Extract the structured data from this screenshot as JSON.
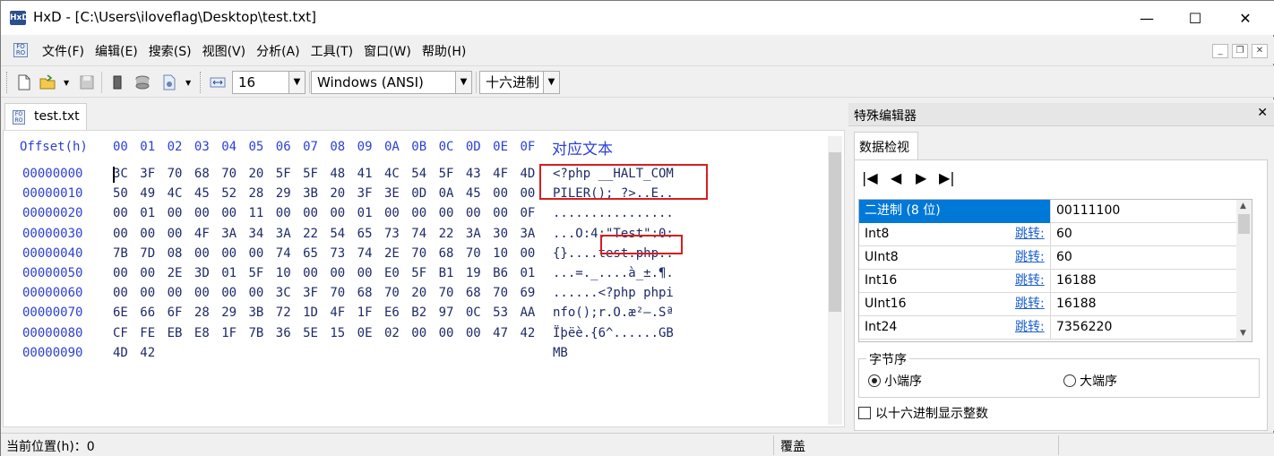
{
  "window": {
    "app_icon": "HxD",
    "title": "HxD - [C:\\Users\\iloveflag\\Desktop\\test.txt]",
    "minimize": "—",
    "maximize": "☐",
    "close": "✕"
  },
  "menu": {
    "items": [
      "文件(F)",
      "编辑(E)",
      "搜索(S)",
      "视图(V)",
      "分析(A)",
      "工具(T)",
      "窗口(W)",
      "帮助(H)"
    ],
    "mdi_min": "_",
    "mdi_restore": "❐",
    "mdi_close": "✕"
  },
  "toolbar": {
    "bytes_per_row": "16",
    "charset": "Windows (ANSI)",
    "offset_base": "十六进制"
  },
  "editor": {
    "tab_label": "test.txt",
    "header_offset": "Offset(h)",
    "header_cols": [
      "00",
      "01",
      "02",
      "03",
      "04",
      "05",
      "06",
      "07",
      "08",
      "09",
      "0A",
      "0B",
      "0C",
      "0D",
      "0E",
      "0F"
    ],
    "header_text": "对应文本",
    "rows": [
      {
        "offset": "00000000",
        "bytes": [
          "3C",
          "3F",
          "70",
          "68",
          "70",
          "20",
          "5F",
          "5F",
          "48",
          "41",
          "4C",
          "54",
          "5F",
          "43",
          "4F",
          "4D"
        ],
        "text": "<?php __HALT_COM"
      },
      {
        "offset": "00000010",
        "bytes": [
          "50",
          "49",
          "4C",
          "45",
          "52",
          "28",
          "29",
          "3B",
          "20",
          "3F",
          "3E",
          "0D",
          "0A",
          "45",
          "00",
          "00"
        ],
        "text": "PILER(); ?>..E.."
      },
      {
        "offset": "00000020",
        "bytes": [
          "00",
          "01",
          "00",
          "00",
          "00",
          "11",
          "00",
          "00",
          "00",
          "01",
          "00",
          "00",
          "00",
          "00",
          "00",
          "0F"
        ],
        "text": "................"
      },
      {
        "offset": "00000030",
        "bytes": [
          "00",
          "00",
          "00",
          "4F",
          "3A",
          "34",
          "3A",
          "22",
          "54",
          "65",
          "73",
          "74",
          "22",
          "3A",
          "30",
          "3A"
        ],
        "text": "...O:4:\"Test\":0:"
      },
      {
        "offset": "00000040",
        "bytes": [
          "7B",
          "7D",
          "08",
          "00",
          "00",
          "00",
          "74",
          "65",
          "73",
          "74",
          "2E",
          "70",
          "68",
          "70",
          "10",
          "00"
        ],
        "text": "{}....test.php.."
      },
      {
        "offset": "00000050",
        "bytes": [
          "00",
          "00",
          "2E",
          "3D",
          "01",
          "5F",
          "10",
          "00",
          "00",
          "00",
          "E0",
          "5F",
          "B1",
          "19",
          "B6",
          "01"
        ],
        "text": "...=._....à_±.¶."
      },
      {
        "offset": "00000060",
        "bytes": [
          "00",
          "00",
          "00",
          "00",
          "00",
          "00",
          "3C",
          "3F",
          "70",
          "68",
          "70",
          "20",
          "70",
          "68",
          "70",
          "69"
        ],
        "text": "......<?php phpi"
      },
      {
        "offset": "00000070",
        "bytes": [
          "6E",
          "66",
          "6F",
          "28",
          "29",
          "3B",
          "72",
          "1D",
          "4F",
          "1F",
          "E6",
          "B2",
          "97",
          "0C",
          "53",
          "AA"
        ],
        "text": "nfo();r.O.æ²—.Sª"
      },
      {
        "offset": "00000080",
        "bytes": [
          "CF",
          "FE",
          "EB",
          "E8",
          "1F",
          "7B",
          "36",
          "5E",
          "15",
          "0E",
          "02",
          "00",
          "00",
          "00",
          "47",
          "42"
        ],
        "text": "Ïþëè.{6^......GB"
      },
      {
        "offset": "00000090",
        "bytes": [
          "4D",
          "42"
        ],
        "text": "MB"
      }
    ]
  },
  "inspector": {
    "panel_title": "特殊编辑器",
    "close": "✕",
    "tab_label": "数据检视",
    "nav": [
      "|◀",
      "◀",
      "▶",
      "▶|"
    ],
    "rows": [
      {
        "label": "二进制 (8 位)",
        "jump": "",
        "value": "00111100"
      },
      {
        "label": "Int8",
        "jump": "跳转:",
        "value": "60"
      },
      {
        "label": "UInt8",
        "jump": "跳转:",
        "value": "60"
      },
      {
        "label": "Int16",
        "jump": "跳转:",
        "value": "16188"
      },
      {
        "label": "UInt16",
        "jump": "跳转:",
        "value": "16188"
      },
      {
        "label": "Int24",
        "jump": "跳转:",
        "value": "7356220"
      }
    ],
    "byte_order_label": "字节序",
    "little_endian": "小端序",
    "big_endian": "大端序",
    "hex_display_label": "以十六进制显示整数"
  },
  "status": {
    "position": "当前位置(h)：0",
    "mode": "覆盖"
  }
}
